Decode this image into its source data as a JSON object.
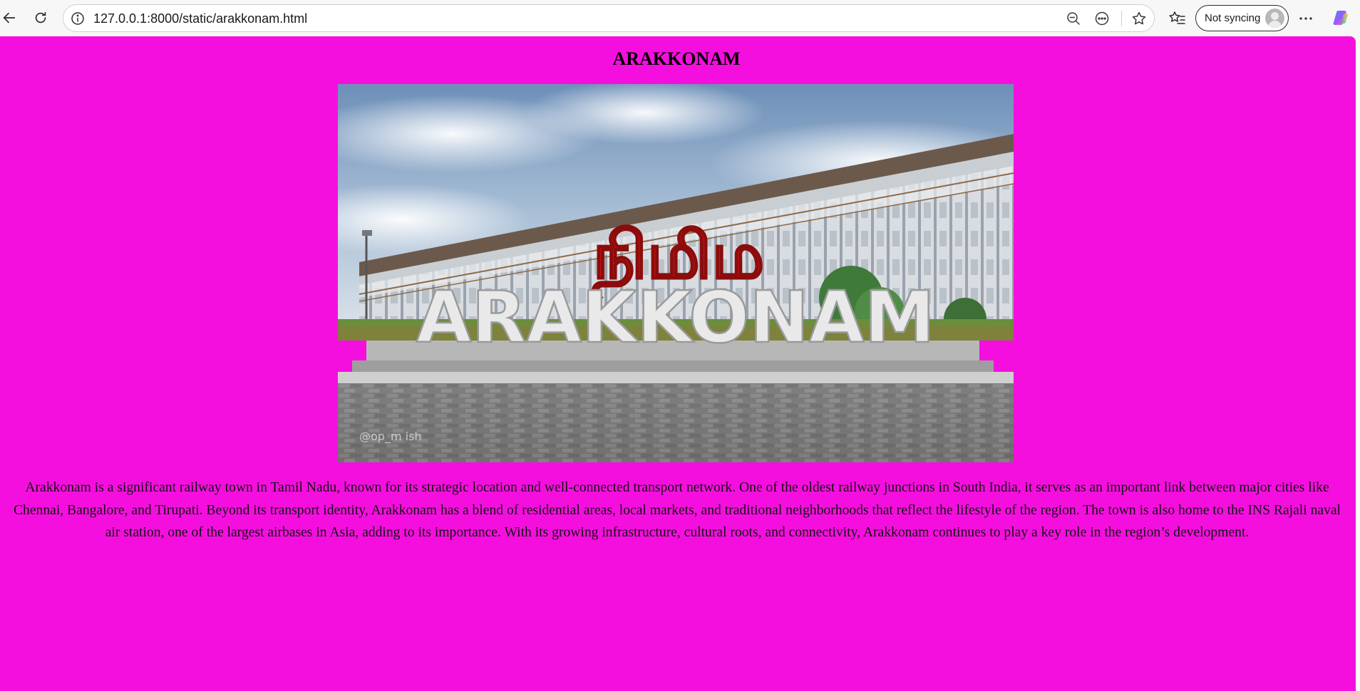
{
  "browser": {
    "url": "127.0.0.1:8000/static/arakkonam.html",
    "sync_label": "Not syncing",
    "icons": [
      "back-icon",
      "refresh-icon",
      "info-icon",
      "zoom-out-icon",
      "more-circle-icon",
      "favorite-star-icon",
      "favorites-list-icon",
      "avatar-icon",
      "menu-dots-icon",
      "copilot-icon"
    ]
  },
  "page": {
    "background_color": "#f50fdf",
    "title": "ARAKKONAM",
    "hero_image": {
      "sign_top_text": "நிமிம",
      "sign_text": "ARAKKONAM",
      "watermark": "@op_m  ish"
    },
    "description": "Arakkonam is a significant railway town in Tamil Nadu, known for its strategic location and well-connected transport network. One of the oldest railway junctions in South India, it serves as an important link between major cities like Chennai, Bangalore, and Tirupati. Beyond its transport identity, Arakkonam has a blend of residential areas, local markets, and traditional neighborhoods that reflect the lifestyle of the region. The town is also home to the INS Rajali naval air station, one of the largest airbases in Asia, adding to its importance. With its growing infrastructure, cultural roots, and connectivity, Arakkonam continues to play a key role in the region’s development."
  }
}
